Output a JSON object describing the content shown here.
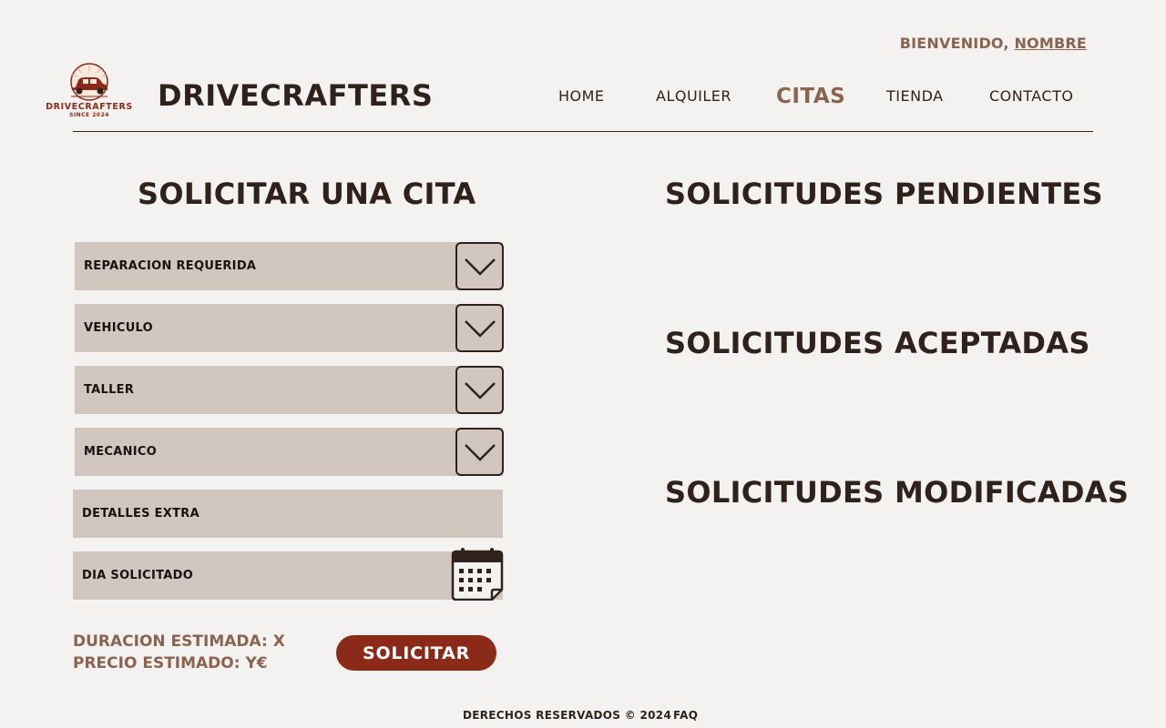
{
  "header": {
    "welcome_prefix": "BIENVENIDO,",
    "welcome_user": "NOMBRE",
    "brand_title": "DRIVECRAFTERS",
    "logo_text": "DRIVECRAFTERS",
    "logo_subtext": "SINCE 2024"
  },
  "nav": {
    "items": [
      {
        "label": "HOME"
      },
      {
        "label": "ALQUILER"
      },
      {
        "label": "CITAS"
      },
      {
        "label": "TIENDA"
      },
      {
        "label": "CONTACTO"
      }
    ],
    "active": "CITAS"
  },
  "form": {
    "title": "SOLICITAR UNA CITA",
    "fields": [
      {
        "label": "REPARACION REQUERIDA",
        "control": "chevron-down-icon"
      },
      {
        "label": "VEHICULO",
        "control": "chevron-down-icon"
      },
      {
        "label": "TALLER",
        "control": "chevron-down-icon"
      },
      {
        "label": "MECANICO",
        "control": "chevron-down-icon"
      },
      {
        "label": "DETALLES EXTRA"
      },
      {
        "label": "DIA SOLICITADO",
        "control": "calendar-icon"
      }
    ],
    "duration": "DURACION ESTIMADA: X",
    "price": "PRECIO ESTIMADO: Y€",
    "submit_label": "SOLICITAR"
  },
  "requests": {
    "pending_title": "SOLICITUDES PENDIENTES",
    "accepted_title": "SOLICITUDES ACEPTADAS",
    "modified_title": "SOLICITUDES MODIFICADAS"
  },
  "footer": {
    "copyright": "DERECHOS RESERVADOS © 2024",
    "faq": "FAQ"
  },
  "colors": {
    "background": "#f4f2f0",
    "text_dark": "#2f221d",
    "accent_brown": "#8a644e",
    "field_bg": "#d2c6c0",
    "button_red": "#8c2a1a",
    "logo_red": "#8c2a1a"
  }
}
